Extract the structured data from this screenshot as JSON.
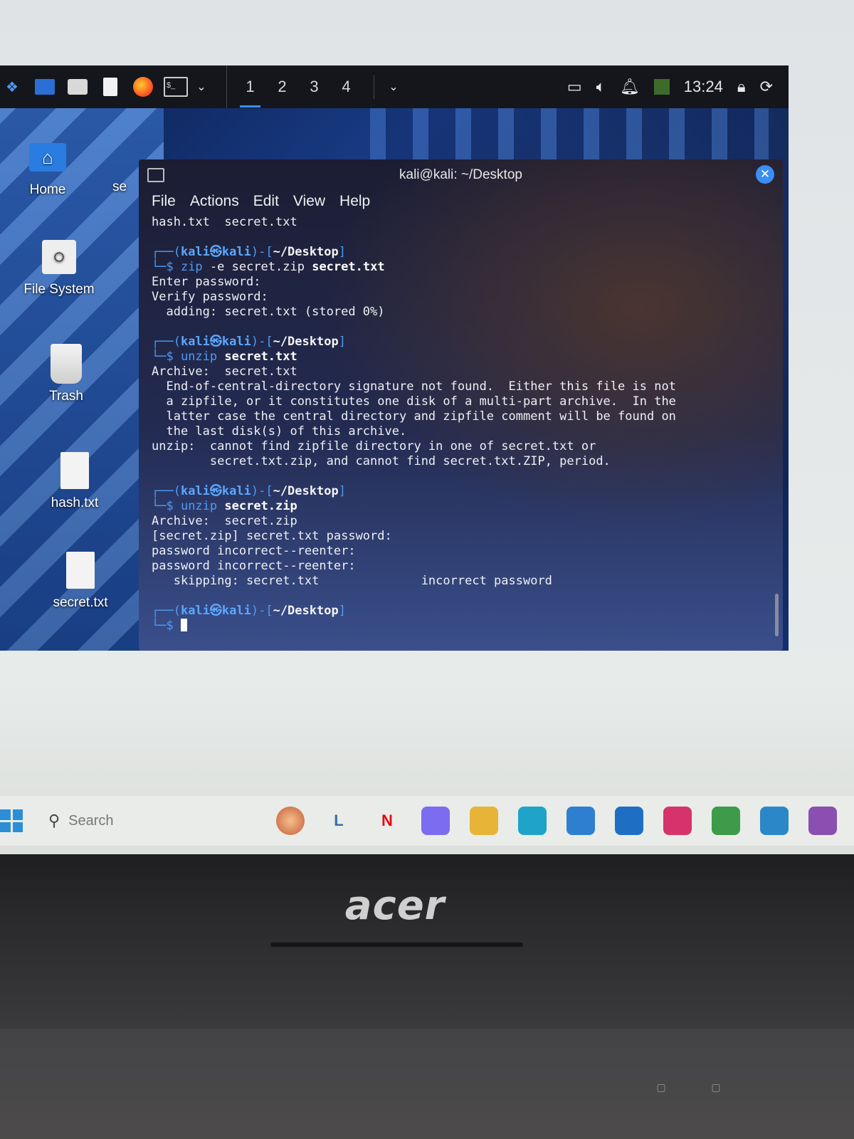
{
  "panel": {
    "workspaces": [
      "1",
      "2",
      "3",
      "4"
    ],
    "active_workspace": "1",
    "clock": "13:24"
  },
  "desktop": {
    "icons": [
      {
        "label": "Home"
      },
      {
        "label": "File System"
      },
      {
        "label": "Trash"
      },
      {
        "label": "hash.txt"
      },
      {
        "label": "secret.txt"
      }
    ],
    "partial_label": "se"
  },
  "terminal": {
    "title": "kali@kali: ~/Desktop",
    "menu": [
      "File",
      "Actions",
      "Edit",
      "View",
      "Help"
    ],
    "ls_output": "hash.txt  secret.txt",
    "prompt_user": "kali",
    "prompt_host": "kali",
    "prompt_dir": "~/Desktop",
    "commands": [
      {
        "cmd": "zip",
        "args": "-e secret.zip",
        "bold_arg": "secret.txt",
        "output": [
          "Enter password:",
          "Verify password:",
          "  adding: secret.txt (stored 0%)"
        ]
      },
      {
        "cmd": "unzip",
        "args": "",
        "bold_arg": "secret.txt",
        "output": [
          "Archive:  secret.txt",
          "  End-of-central-directory signature not found.  Either this file is not",
          "  a zipfile, or it constitutes one disk of a multi-part archive.  In the",
          "  latter case the central directory and zipfile comment will be found on",
          "  the last disk(s) of this archive.",
          "unzip:  cannot find zipfile directory in one of secret.txt or",
          "        secret.txt.zip, and cannot find secret.txt.ZIP, period."
        ]
      },
      {
        "cmd": "unzip",
        "args": "",
        "bold_arg": "secret.zip",
        "output": [
          "Archive:  secret.zip",
          "[secret.zip] secret.txt password:",
          "password incorrect--reenter:",
          "password incorrect--reenter:",
          "   skipping: secret.txt              incorrect password"
        ]
      }
    ]
  },
  "host_taskbar": {
    "search_placeholder": "Search",
    "apps": [
      {
        "icon": "L",
        "color": "#3a6ea8"
      },
      {
        "icon": "N",
        "color": "#e50914"
      },
      {
        "icon": "copilot-icon",
        "color": "#7b6cf0"
      },
      {
        "icon": "folder-icon",
        "color": "#e8b437"
      },
      {
        "icon": "edge-icon",
        "color": "#1fa3c9"
      },
      {
        "icon": "store-icon",
        "color": "#2f7fd1"
      },
      {
        "icon": "outlook-icon",
        "color": "#1e6fc4"
      },
      {
        "icon": "instagram-icon",
        "color": "#d6336c"
      },
      {
        "icon": "chrome-icon",
        "color": "#3d9b4a"
      },
      {
        "icon": "vs-icon",
        "color": "#2c87c8"
      },
      {
        "icon": "photo-icon",
        "color": "#8a4fb0"
      }
    ]
  },
  "laptop": {
    "brand": "acer"
  }
}
